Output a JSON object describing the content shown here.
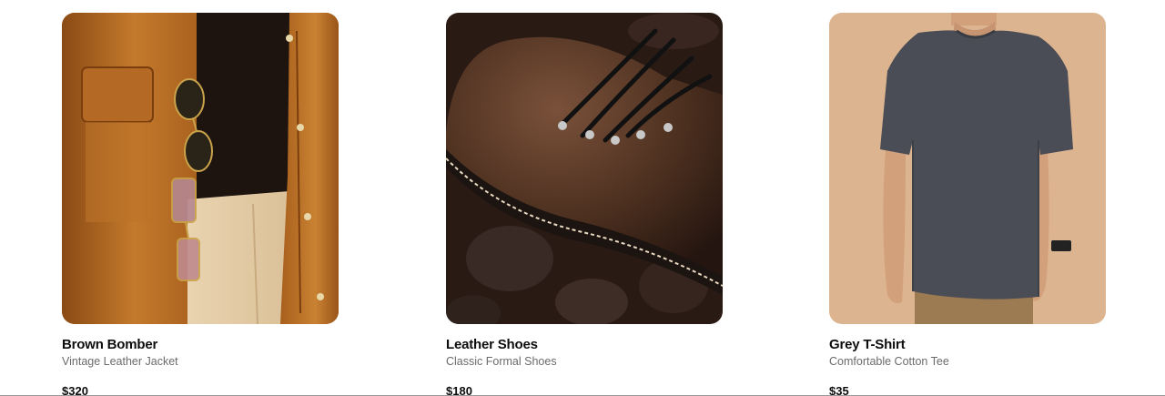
{
  "products": [
    {
      "name": "Brown Bomber",
      "description": "Vintage Leather Jacket",
      "price": "$320",
      "image_subject": "brown-leather-jacket-with-sunglasses"
    },
    {
      "name": "Leather Shoes",
      "description": "Classic Formal Shoes",
      "price": "$180",
      "image_subject": "brown-leather-boot-on-rocks"
    },
    {
      "name": "Grey T-Shirt",
      "description": "Comfortable Cotton Tee",
      "price": "$35",
      "image_subject": "man-in-grey-tshirt"
    }
  ],
  "colors": {
    "title": "#0d0d0d",
    "description": "#6b6b6b",
    "background": "#ffffff"
  }
}
